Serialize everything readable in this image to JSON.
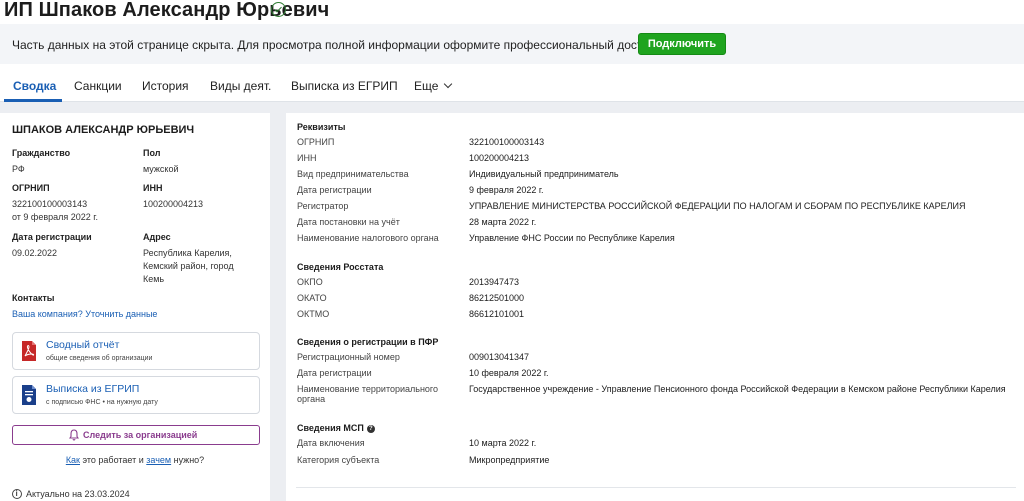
{
  "header": {
    "title": "ИП Шпаков Александр Юрьевич",
    "banner_text": "Часть данных на этой странице скрыта. Для просмотра полной информации оформите профессиональный доступ",
    "connect_label": "Подключить"
  },
  "tabs": [
    {
      "label": "Сводка",
      "active": true
    },
    {
      "label": "Санкции"
    },
    {
      "label": "История"
    },
    {
      "label": "Виды деят."
    },
    {
      "label": "Выписка из ЕГРИП"
    },
    {
      "label": "Еще"
    }
  ],
  "left": {
    "name": "ШПАКОВ АЛЕКСАНДР ЮРЬЕВИЧ",
    "citizenship_label": "Гражданство",
    "citizenship_value": "РФ",
    "sex_label": "Пол",
    "sex_value": "мужской",
    "ogrnip_label": "ОГРНИП",
    "ogrnip_value": "322100100003143",
    "ogrnip_date": "от 9 февраля 2022 г.",
    "inn_label": "ИНН",
    "inn_value": "100200004213",
    "reg_date_label": "Дата регистрации",
    "reg_date_value": "09.02.2022",
    "address_label": "Адрес",
    "address_line1": "Республика Карелия,",
    "address_line2": "Кемский район, город",
    "address_line3": "Кемь",
    "contacts_label": "Контакты",
    "contacts_link": "Ваша компания? Уточнить данные",
    "doc1_title": "Сводный отчёт",
    "doc1_sub": "общие сведения об организации",
    "doc2_title": "Выписка из ЕГРИП",
    "doc2_sub": "с подписью ФНС • на нужную дату",
    "follow_label": "Следить за организацией",
    "howto_1": "Как",
    "howto_2": " это работает и ",
    "howto_3": "зачем",
    "howto_4": " нужно?",
    "actual": "Актуально на 23.03.2024"
  },
  "right": {
    "rekv": {
      "title": "Реквизиты",
      "rows": [
        {
          "label": "ОГРНИП",
          "value": "322100100003143"
        },
        {
          "label": "ИНН",
          "value": "100200004213"
        },
        {
          "label": "Вид предпринимательства",
          "value": "Индивидуальный предприниматель"
        },
        {
          "label": "Дата регистрации",
          "value": "9 февраля 2022 г."
        },
        {
          "label": "Регистратор",
          "value": "УПРАВЛЕНИЕ МИНИСТЕРСТВА РОССИЙСКОЙ ФЕДЕРАЦИИ ПО НАЛОГАМ И СБОРАМ ПО РЕСПУБЛИКЕ КАРЕЛИЯ"
        },
        {
          "label": "Дата постановки на учёт",
          "value": "28 марта 2022 г."
        },
        {
          "label": "Наименование налогового органа",
          "value": "Управление ФНС России по Республике Карелия"
        }
      ]
    },
    "rosstat": {
      "title": "Сведения Росстата",
      "rows": [
        {
          "label": "ОКПО",
          "value": "2013947473"
        },
        {
          "label": "ОКАТО",
          "value": "86212501000"
        },
        {
          "label": "ОКТМО",
          "value": "86612101001"
        }
      ]
    },
    "pfr": {
      "title": "Сведения о регистрации в ПФР",
      "rows": [
        {
          "label": "Регистрационный номер",
          "value": "009013041347"
        },
        {
          "label": "Дата регистрации",
          "value": "10 февраля 2022 г."
        },
        {
          "label": "Наименование территориального органа",
          "value": "Государственное учреждение - Управление Пенсионного фонда Российской Федерации в Кемском районе Республики Карелия"
        }
      ]
    },
    "msp": {
      "title": "Сведения МСП",
      "help_icon": "?",
      "rows": [
        {
          "label": "Дата включения",
          "value": "10 марта 2022 г."
        },
        {
          "label": "Категория субъекта",
          "value": "Микропредприятие"
        }
      ]
    }
  }
}
